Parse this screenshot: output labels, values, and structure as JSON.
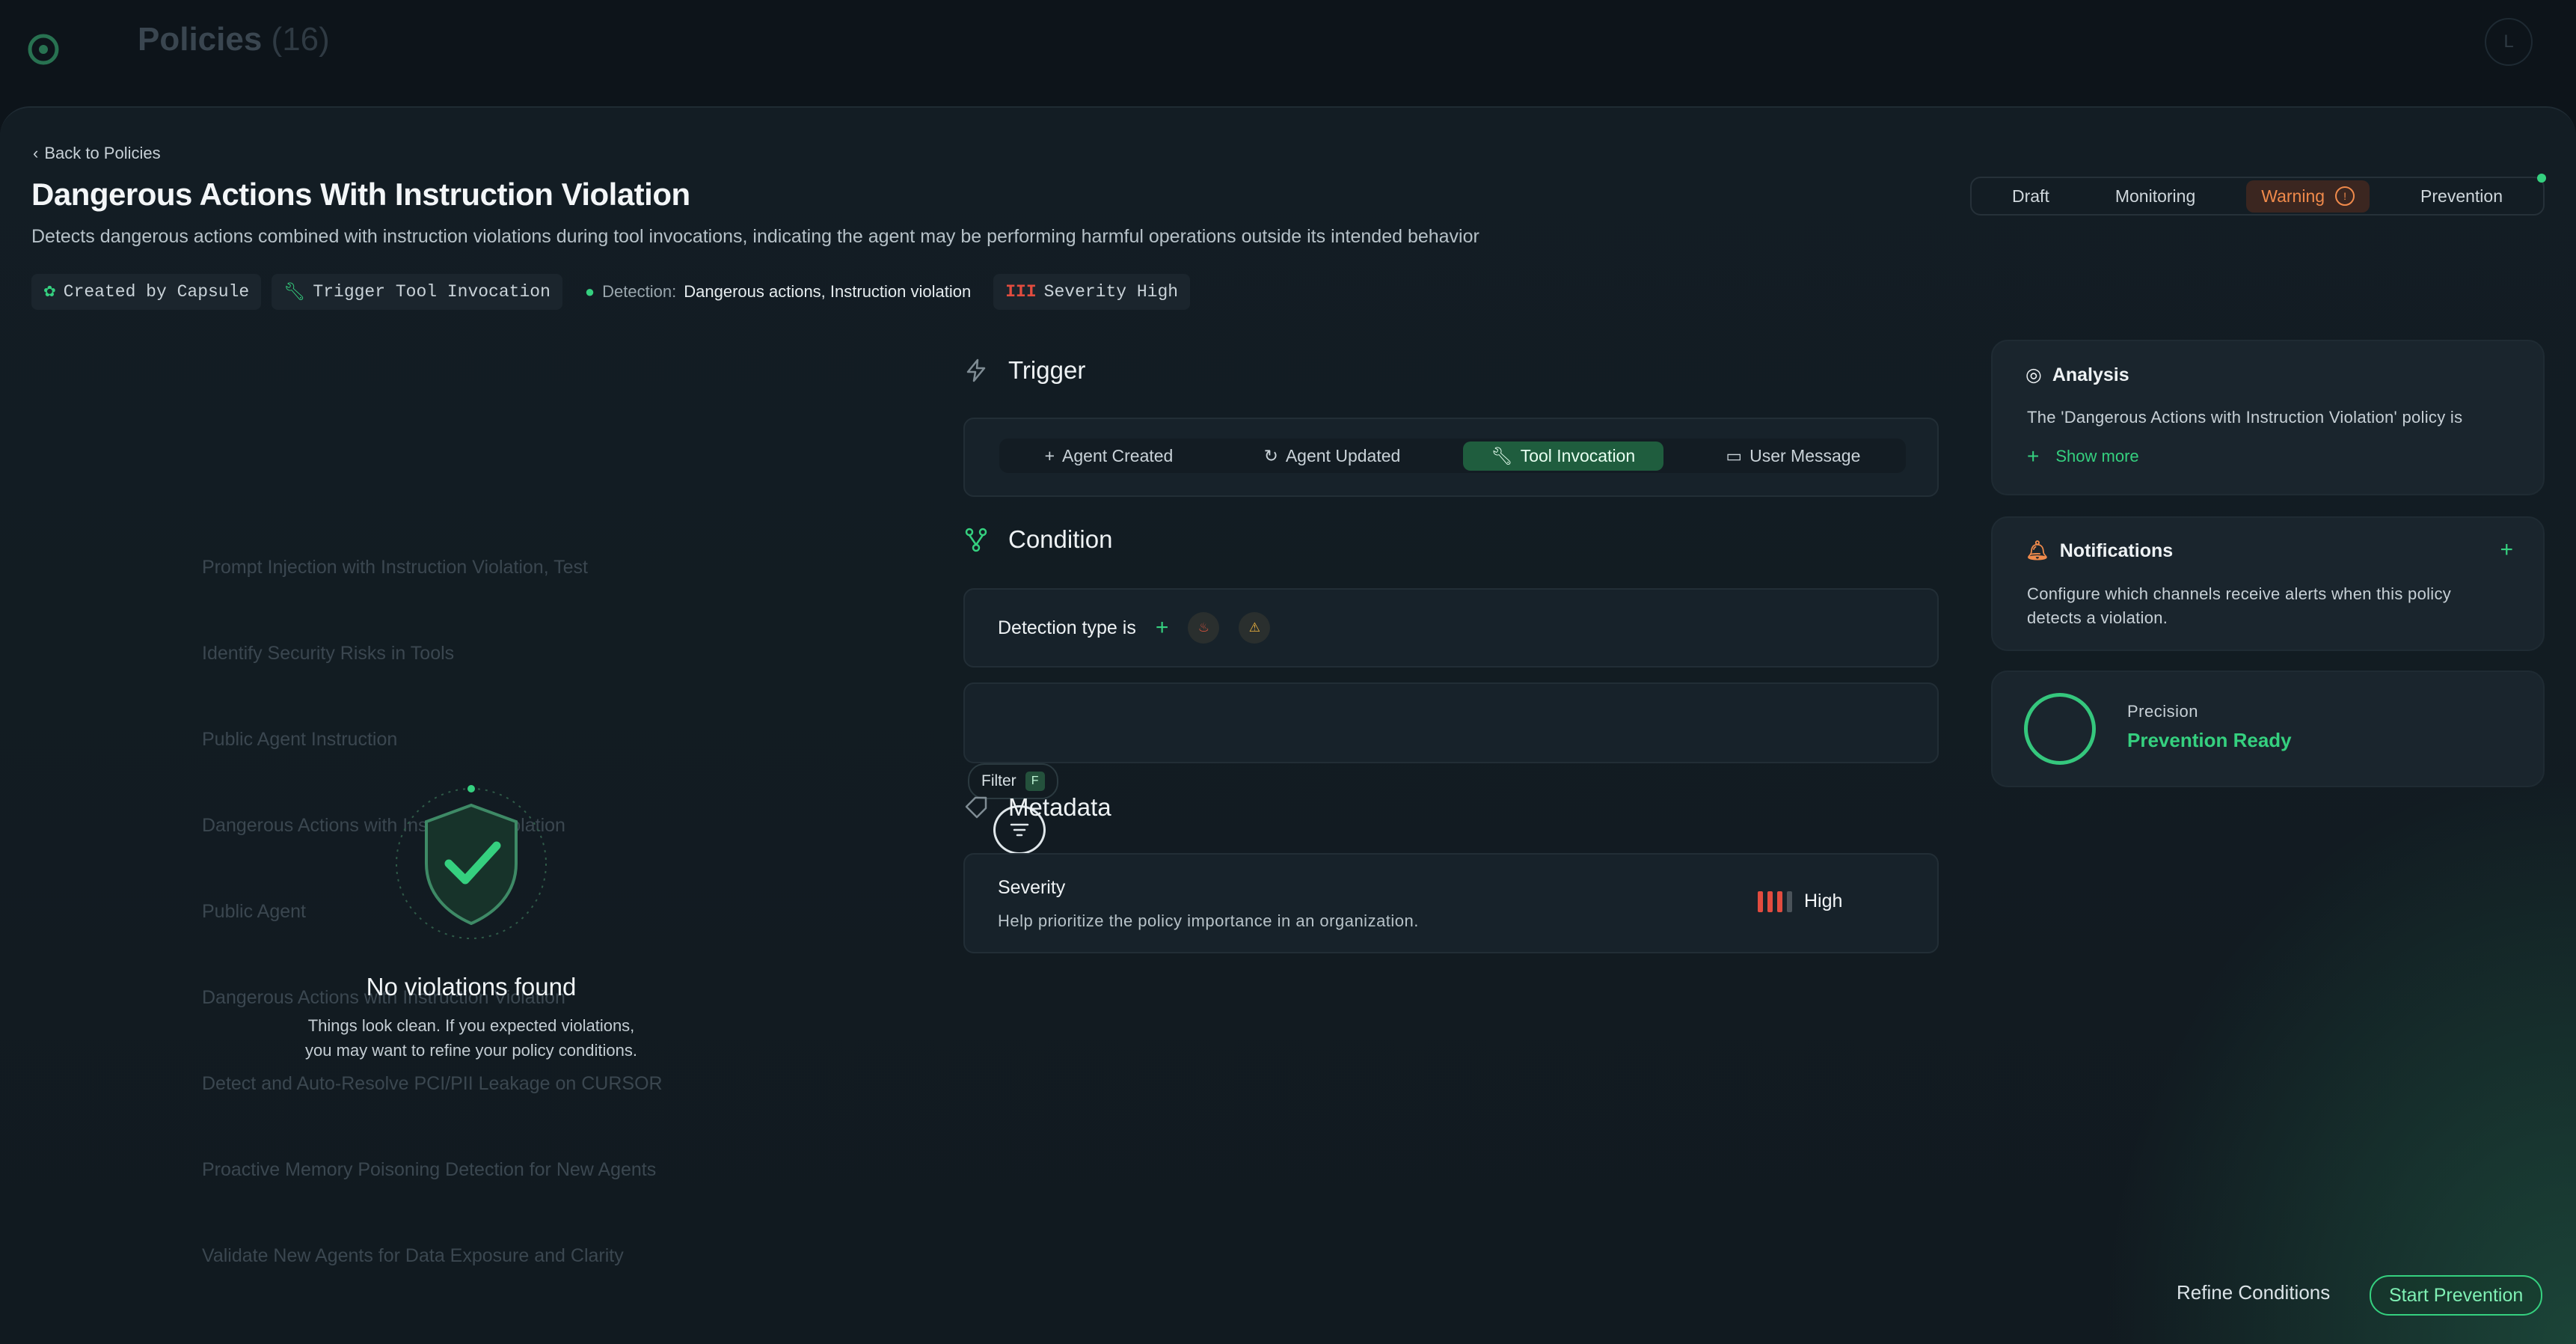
{
  "background": {
    "app_title": "Policies",
    "count": "(16)",
    "avatar_initial": "L",
    "rows": [
      {
        "name": "Prompt Injection with Instruction Violation, Test"
      },
      {
        "name": "Identify Security Risks in Tools"
      },
      {
        "name": "Public Agent Instruction"
      },
      {
        "name": "Dangerous Actions with Instruction Violation"
      },
      {
        "name": "Public Agent"
      },
      {
        "name": "Dangerous Actions with Instruction Violation"
      },
      {
        "name": "Detect and Auto-Resolve PCI/PII Leakage on CURSOR"
      },
      {
        "name": "Proactive Memory Poisoning Detection for New Agents"
      },
      {
        "name": "Validate New Agents for Data Exposure and Clarity"
      }
    ]
  },
  "header": {
    "back_label": "Back to Policies",
    "title": "Dangerous Actions With Instruction Violation",
    "description": "Detects dangerous actions combined with instruction violations during tool invocations, indicating the agent may be performing harmful operations outside its intended behavior",
    "tags": {
      "created_by": "Created by Capsule",
      "trigger": "Trigger Tool Invocation",
      "detection_key": "Detection:",
      "detection_val": "Dangerous actions, Instruction violation",
      "severity": "Severity High"
    }
  },
  "status": {
    "options": [
      "Draft",
      "Monitoring",
      "Warning",
      "Prevention"
    ],
    "active": "Warning",
    "warn_icon": "!"
  },
  "empty_state": {
    "title": "No violations found",
    "subtitle_line1": "Things look clean. If you expected violations,",
    "subtitle_line2": "you may want to refine your policy conditions."
  },
  "trigger": {
    "title": "Trigger",
    "options": [
      "Agent Created",
      "Agent Updated",
      "Tool Invocation",
      "User Message"
    ],
    "active": "Tool Invocation"
  },
  "condition": {
    "title": "Condition",
    "row_label": "Detection type is",
    "filter_label": "Filter",
    "filter_key": "F"
  },
  "metadata": {
    "title": "Metadata",
    "severity_title": "Severity",
    "severity_help": "Help prioritize the policy importance in an organization.",
    "severity_value": "High",
    "severity_level": 3,
    "severity_max": 4
  },
  "analysis": {
    "title": "Analysis",
    "text": "The 'Dangerous Actions with Instruction Violation' policy is",
    "show_more": "Show more"
  },
  "notifications": {
    "title": "Notifications",
    "line1": "Configure which channels receive alerts when this policy",
    "line2": "detects a violation."
  },
  "precision": {
    "label": "Precision",
    "value": "Prevention Ready"
  },
  "footer": {
    "refine": "Refine Conditions",
    "start": "Start Prevention"
  },
  "colors": {
    "accent": "#35d07f",
    "warning": "#f08a4b",
    "severity": "#e24c3f"
  }
}
